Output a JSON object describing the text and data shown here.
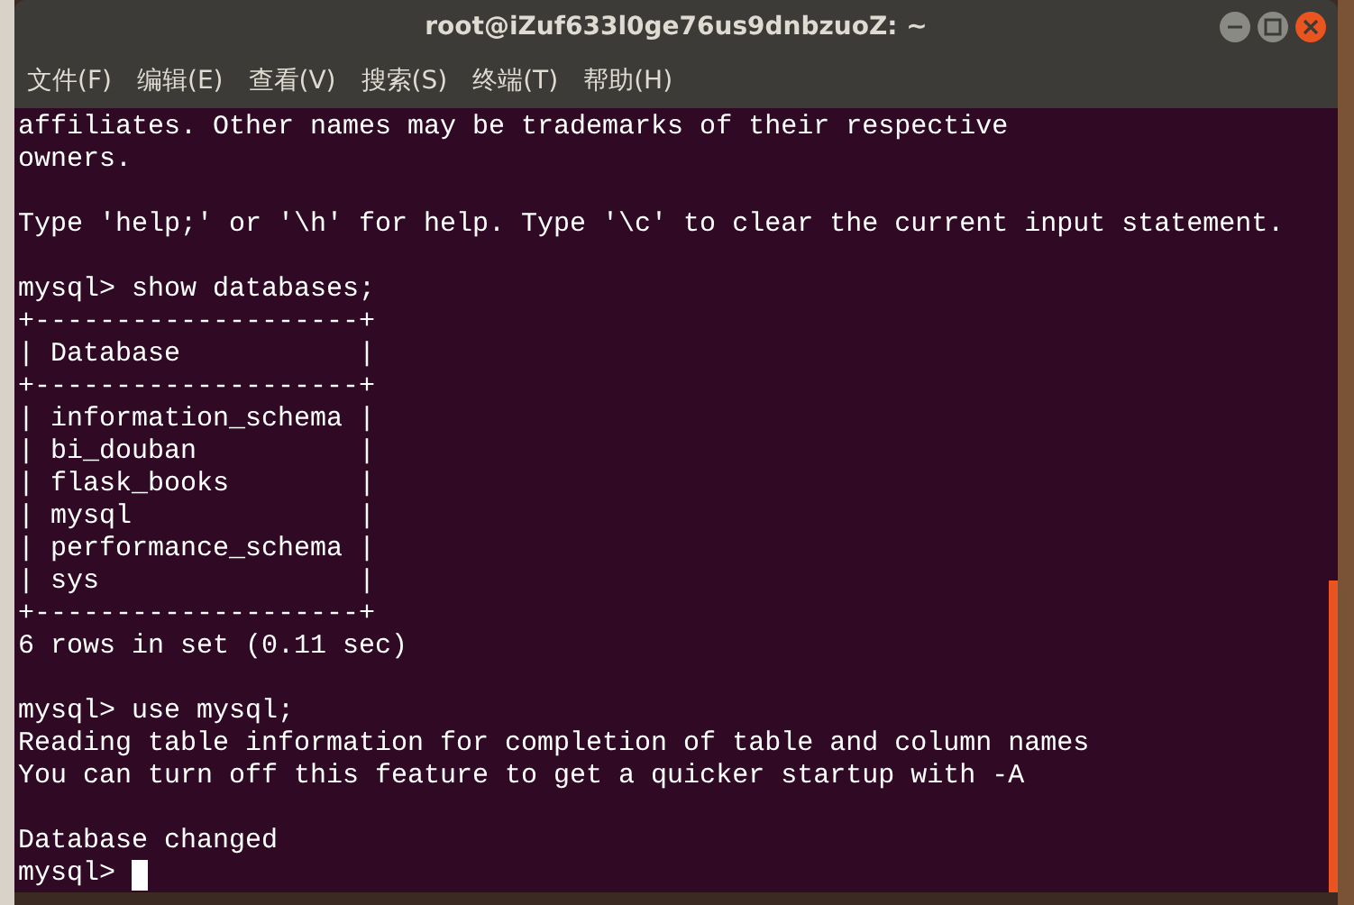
{
  "window": {
    "title": "root@iZuf633l0ge76us9dnbzuoZ: ~"
  },
  "menu": [
    "文件(F)",
    "编辑(E)",
    "查看(V)",
    "搜索(S)",
    "终端(T)",
    "帮助(H)"
  ],
  "terminal": {
    "blocks": [
      [
        "affiliates. Other names may be trademarks of their respective",
        "owners."
      ],
      [
        "Type 'help;' or '\\h' for help. Type '\\c' to clear the current input statement."
      ],
      [
        "mysql> show databases;",
        "+--------------------+",
        "| Database           |",
        "+--------------------+",
        "| information_schema |",
        "| bi_douban          |",
        "| flask_books        |",
        "| mysql              |",
        "| performance_schema |",
        "| sys                |",
        "+--------------------+",
        "6 rows in set (0.11 sec)"
      ],
      [
        "mysql> use mysql;",
        "Reading table information for completion of table and column names",
        "You can turn off this feature to get a quicker startup with -A"
      ],
      [
        "Database changed"
      ]
    ],
    "prompt": "mysql> "
  }
}
